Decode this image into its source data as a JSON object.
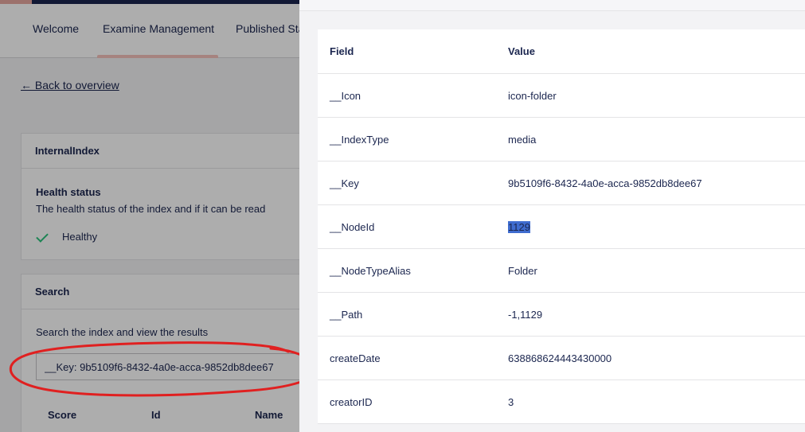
{
  "tabs": [
    {
      "label": "Welcome"
    },
    {
      "label": "Examine Management"
    },
    {
      "label": "Published Sta"
    }
  ],
  "back_link": "← Back to overview",
  "index_card": {
    "title": "InternalIndex",
    "health_title": "Health status",
    "health_desc": "The health status of the index and if it can be read",
    "health_value": "Healthy"
  },
  "search_card": {
    "title": "Search",
    "desc": "Search the index and view the results",
    "input_value": "__Key: 9b5109f6-8432-4a0e-acca-9852db8dee67",
    "columns": [
      "Score",
      "Id",
      "Name"
    ]
  },
  "fields_table": {
    "header": {
      "field": "Field",
      "value": "Value"
    },
    "rows": [
      {
        "field": "__Icon",
        "value": "icon-folder"
      },
      {
        "field": "__IndexType",
        "value": "media"
      },
      {
        "field": "__Key",
        "value": "9b5109f6-8432-4a0e-acca-9852db8dee67"
      },
      {
        "field": "__NodeId",
        "value": "1129"
      },
      {
        "field": "__NodeTypeAlias",
        "value": "Folder"
      },
      {
        "field": "__Path",
        "value": "-1,1129"
      },
      {
        "field": "createDate",
        "value": "638868624443430000"
      },
      {
        "field": "creatorID",
        "value": "3"
      }
    ]
  },
  "colors": {
    "accent": "#f5c1bc",
    "healthy": "#2bc37c",
    "selection": "#3f6ccf",
    "annotation": "#e02020"
  },
  "icons": {
    "health": "check-icon"
  }
}
